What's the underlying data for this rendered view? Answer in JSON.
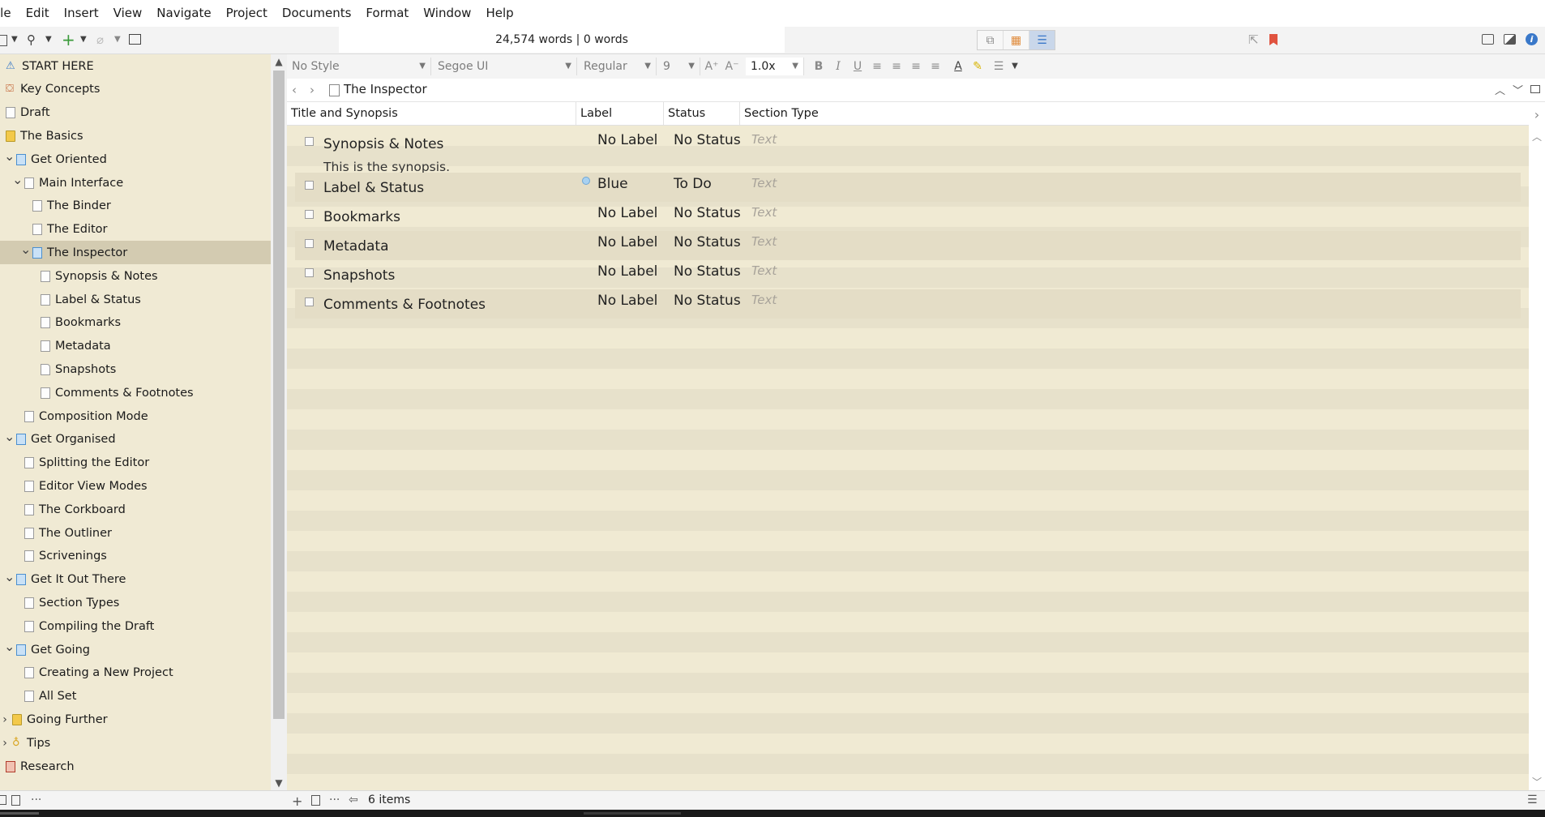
{
  "menu": [
    "ile",
    "Edit",
    "Insert",
    "View",
    "Navigate",
    "Project",
    "Documents",
    "Format",
    "Window",
    "Help"
  ],
  "toolbar": {
    "word_count": "24,574 words | 0 words"
  },
  "binder": {
    "items": [
      {
        "label": "START HERE",
        "icon": "warning-icon",
        "level": 0,
        "chevron": ""
      },
      {
        "label": "Key Concepts",
        "icon": "presentation-icon",
        "level": 0,
        "chevron": ""
      },
      {
        "label": "Draft",
        "icon": "draft-icon",
        "level": 0,
        "chevron": ""
      },
      {
        "label": "The Basics",
        "icon": "folder-icon",
        "level": 0,
        "chevron": ""
      },
      {
        "label": "Get Oriented",
        "icon": "folder-doc-icon",
        "level": 1,
        "chevron": "open"
      },
      {
        "label": "Main Interface",
        "icon": "document-icon",
        "level": 2,
        "chevron": "open"
      },
      {
        "label": "The Binder",
        "icon": "document-icon",
        "level": 3,
        "chevron": ""
      },
      {
        "label": "The Editor",
        "icon": "document-icon",
        "level": 3,
        "chevron": ""
      },
      {
        "label": "The Inspector",
        "icon": "folder-doc-icon",
        "level": 3,
        "chevron": "open",
        "selected": true
      },
      {
        "label": "Synopsis & Notes",
        "icon": "document-icon",
        "level": 4,
        "chevron": ""
      },
      {
        "label": "Label & Status",
        "icon": "document-icon",
        "level": 4,
        "chevron": ""
      },
      {
        "label": "Bookmarks",
        "icon": "document-icon",
        "level": 4,
        "chevron": ""
      },
      {
        "label": "Metadata",
        "icon": "document-icon",
        "level": 4,
        "chevron": ""
      },
      {
        "label": "Snapshots",
        "icon": "snapshot-document-icon",
        "level": 4,
        "chevron": ""
      },
      {
        "label": "Comments & Footnotes",
        "icon": "document-icon",
        "level": 4,
        "chevron": ""
      },
      {
        "label": "Composition Mode",
        "icon": "document-icon",
        "level": 2,
        "chevron": ""
      },
      {
        "label": "Get Organised",
        "icon": "folder-doc-icon",
        "level": 1,
        "chevron": "open"
      },
      {
        "label": "Splitting the Editor",
        "icon": "document-icon",
        "level": 2,
        "chevron": ""
      },
      {
        "label": "Editor View Modes",
        "icon": "document-icon",
        "level": 2,
        "chevron": ""
      },
      {
        "label": "The Corkboard",
        "icon": "document-icon",
        "level": 2,
        "chevron": ""
      },
      {
        "label": "The Outliner",
        "icon": "document-icon",
        "level": 2,
        "chevron": ""
      },
      {
        "label": "Scrivenings",
        "icon": "document-icon",
        "level": 2,
        "chevron": ""
      },
      {
        "label": "Get It Out There",
        "icon": "folder-doc-icon",
        "level": 1,
        "chevron": "open"
      },
      {
        "label": "Section Types",
        "icon": "document-icon",
        "level": 2,
        "chevron": ""
      },
      {
        "label": "Compiling the Draft",
        "icon": "document-icon",
        "level": 2,
        "chevron": ""
      },
      {
        "label": "Get Going",
        "icon": "folder-doc-icon",
        "level": 1,
        "chevron": "open"
      },
      {
        "label": "Creating a New Project",
        "icon": "document-icon",
        "level": 2,
        "chevron": ""
      },
      {
        "label": "All Set",
        "icon": "document-icon",
        "level": 2,
        "chevron": ""
      },
      {
        "label": "Going Further",
        "icon": "folder-icon",
        "level": 0,
        "chevron": "closed"
      },
      {
        "label": "Tips",
        "icon": "lightbulb-icon",
        "level": 0,
        "chevron": "closed"
      },
      {
        "label": "Research",
        "icon": "research-icon",
        "level": 0,
        "chevron": ""
      }
    ]
  },
  "formatbar": {
    "style": "No Style",
    "font": "Segoe UI",
    "weight": "Regular",
    "size": "9",
    "line_spacing": "1.0x"
  },
  "header": {
    "title": "The Inspector"
  },
  "outliner": {
    "columns": [
      "Title and Synopsis",
      "Label",
      "Status",
      "Section Type"
    ],
    "rows": [
      {
        "title": "Synopsis & Notes",
        "synopsis": "This is the synopsis.",
        "label": "No Label",
        "status": "No Status",
        "section_type": "Text"
      },
      {
        "title": "Label & Status",
        "synopsis": "",
        "label": "Blue",
        "status": "To Do",
        "section_type": "Text",
        "label_color": "#a8d1f1"
      },
      {
        "title": "Bookmarks",
        "synopsis": "",
        "label": "No Label",
        "status": "No Status",
        "section_type": "Text"
      },
      {
        "title": "Metadata",
        "synopsis": "",
        "label": "No Label",
        "status": "No Status",
        "section_type": "Text"
      },
      {
        "title": "Snapshots",
        "synopsis": "",
        "label": "No Label",
        "status": "No Status",
        "section_type": "Text"
      },
      {
        "title": "Comments & Footnotes",
        "synopsis": "",
        "label": "No Label",
        "status": "No Status",
        "section_type": "Text"
      }
    ]
  },
  "footer": {
    "items_count": "6 items"
  },
  "colors": {
    "binder_bg": "#f0ead4",
    "binder_selected": "#d3cbb1",
    "outliner_stripe_a": "#f0ead3",
    "outliner_stripe_b": "#e7e1cb",
    "accent_blue": "#3a78c9",
    "bookmark_red": "#e0533f"
  }
}
